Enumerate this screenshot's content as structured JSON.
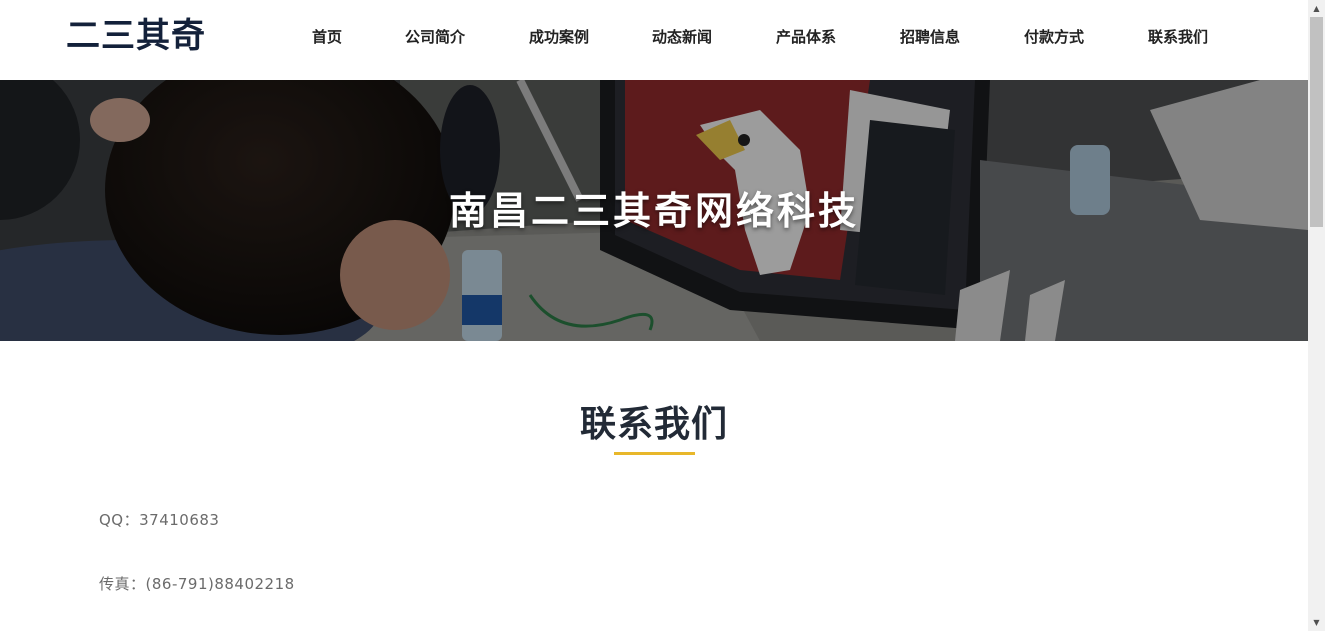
{
  "header": {
    "logo": "二三其奇",
    "nav": [
      {
        "label": "首页"
      },
      {
        "label": "公司简介"
      },
      {
        "label": "成功案例"
      },
      {
        "label": "动态新闻"
      },
      {
        "label": "产品体系"
      },
      {
        "label": "招聘信息"
      },
      {
        "label": "付款方式"
      },
      {
        "label": "联系我们"
      }
    ]
  },
  "banner": {
    "title": "南昌二三其奇网络科技"
  },
  "section": {
    "title": "联系我们",
    "accent_color": "#e8b72a",
    "contacts": [
      {
        "text": "QQ：37410683"
      },
      {
        "text": "传真：(86-791)88402218"
      }
    ]
  },
  "scrollbar": {
    "up_icon": "arrow-up-icon",
    "down_icon": "arrow-down-icon"
  }
}
